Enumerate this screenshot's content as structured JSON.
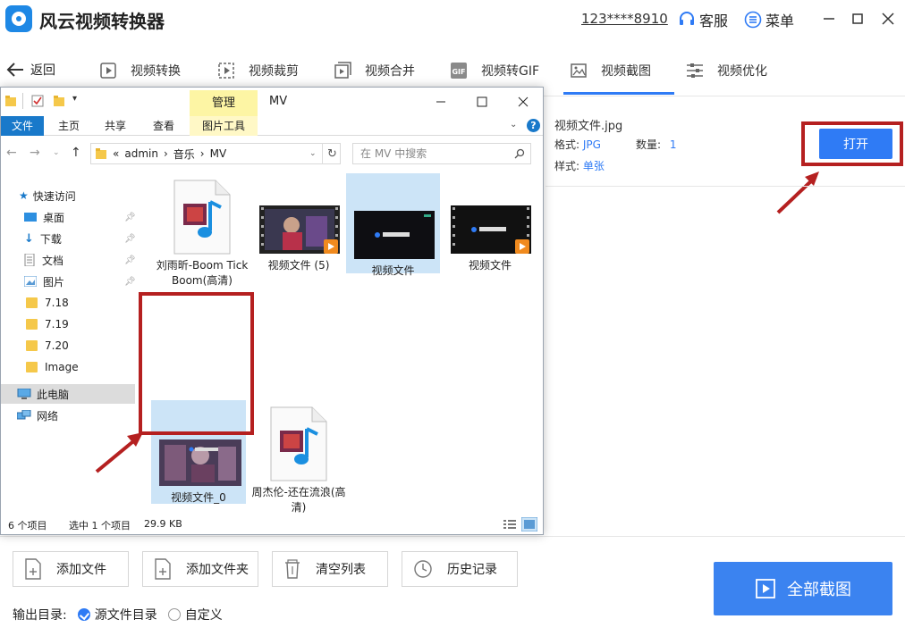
{
  "app": {
    "title": "风云视频转换器",
    "account": "123****8910",
    "service_label": "客服",
    "menu_label": "菜单"
  },
  "nav": {
    "back_label": "返回",
    "tabs": [
      {
        "label": "视频转换",
        "icon": "video-convert-icon"
      },
      {
        "label": "视频裁剪",
        "icon": "video-crop-icon"
      },
      {
        "label": "视频合并",
        "icon": "video-merge-icon"
      },
      {
        "label": "视频转GIF",
        "icon": "gif-icon"
      },
      {
        "label": "视频截图",
        "icon": "screenshot-icon",
        "active": true
      },
      {
        "label": "视频优化",
        "icon": "optimize-icon"
      }
    ]
  },
  "file_info": {
    "name": "视频文件.jpg",
    "format_label": "格式:",
    "format_value": "JPG",
    "count_label": "数量:",
    "count_value": "1",
    "style_label": "样式:",
    "style_value": "单张"
  },
  "open_button": "打开",
  "bottom": {
    "add_file": "添加文件",
    "add_folder": "添加文件夹",
    "clear_list": "清空列表",
    "history": "历史记录",
    "capture_all": "全部截图",
    "output_label": "输出目录:",
    "option_source": "源文件目录",
    "option_custom": "自定义"
  },
  "explorer": {
    "context_tab": "管理",
    "window_title": "MV",
    "tabs": {
      "file": "文件",
      "home": "主页",
      "share": "共享",
      "view": "查看",
      "picture_tools": "图片工具"
    },
    "breadcrumb": [
      "«",
      "admin",
      "›",
      "音乐",
      "›",
      "MV"
    ],
    "search_placeholder": "在 MV 中搜索",
    "sidebar": {
      "quick_access": "快速访问",
      "desktop": "桌面",
      "downloads": "下载",
      "documents": "文档",
      "pictures": "图片",
      "f718": "7.18",
      "f719": "7.19",
      "f720": "7.20",
      "image": "Image",
      "this_pc": "此电脑",
      "network": "网络"
    },
    "files": [
      {
        "name": "刘雨昕-Boom Tick Boom(高清)",
        "kind": "media"
      },
      {
        "name": "视频文件 (5)",
        "kind": "video"
      },
      {
        "name": "视频文件",
        "kind": "image"
      },
      {
        "name": "视频文件",
        "kind": "video"
      },
      {
        "name": "视频文件_0",
        "kind": "image"
      },
      {
        "name": "周杰伦-还在流浪(高清)",
        "kind": "media"
      }
    ],
    "status": {
      "count": "6 个项目",
      "selected": "选中 1 个项目",
      "size": "29.9 KB"
    }
  },
  "colors": {
    "accent": "#2f7bf5",
    "highlight_red": "#b52020",
    "explorer_blue": "#1979ca"
  }
}
